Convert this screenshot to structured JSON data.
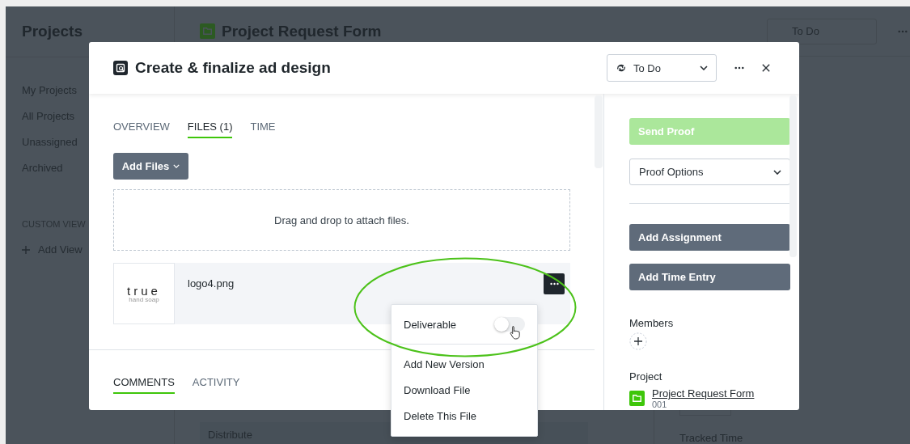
{
  "sidebar": {
    "title": "Projects",
    "items": [
      {
        "label": "My Projects",
        "selected": false
      },
      {
        "label": "All Projects",
        "selected": false
      },
      {
        "label": "Unassigned",
        "selected": false
      },
      {
        "label": "Archived",
        "selected": false
      }
    ],
    "section": "CUSTOM VIEW",
    "add_view": "Add View"
  },
  "page": {
    "title": "Project Request Form",
    "status": "To Do",
    "card_title": "Distribute",
    "tracked_label": "Tracked Time"
  },
  "modal": {
    "title": "Create & finalize ad design",
    "status": "To Do",
    "tabs": [
      {
        "label": "OVERVIEW",
        "selected": false
      },
      {
        "label": "FILES (1)",
        "selected": true
      },
      {
        "label": "TIME",
        "selected": false
      }
    ],
    "add_files": "Add Files",
    "dropzone": "Drag and drop to attach files.",
    "file": {
      "name": "logo4.png",
      "thumbnail_title": "true",
      "thumbnail_subtitle": "hand soap"
    },
    "file_menu": [
      {
        "kind": "toggle",
        "label": "Deliverable",
        "on": false
      },
      {
        "kind": "action",
        "label": "Add New Version"
      },
      {
        "kind": "action",
        "label": "Download File"
      },
      {
        "kind": "action",
        "label": "Delete This File"
      }
    ],
    "bottom_tabs": [
      {
        "label": "COMMENTS",
        "selected": true
      },
      {
        "label": "ACTIVITY",
        "selected": false
      }
    ],
    "side": {
      "send_proof": {
        "label": "Send Proof",
        "disabled": true
      },
      "proof_options": "Proof Options",
      "buttons": [
        "Add Assignment",
        "Add Time Entry"
      ],
      "members_label": "Members",
      "project_label": "Project",
      "project_name": "Project Request Form",
      "project_number": "001"
    }
  }
}
